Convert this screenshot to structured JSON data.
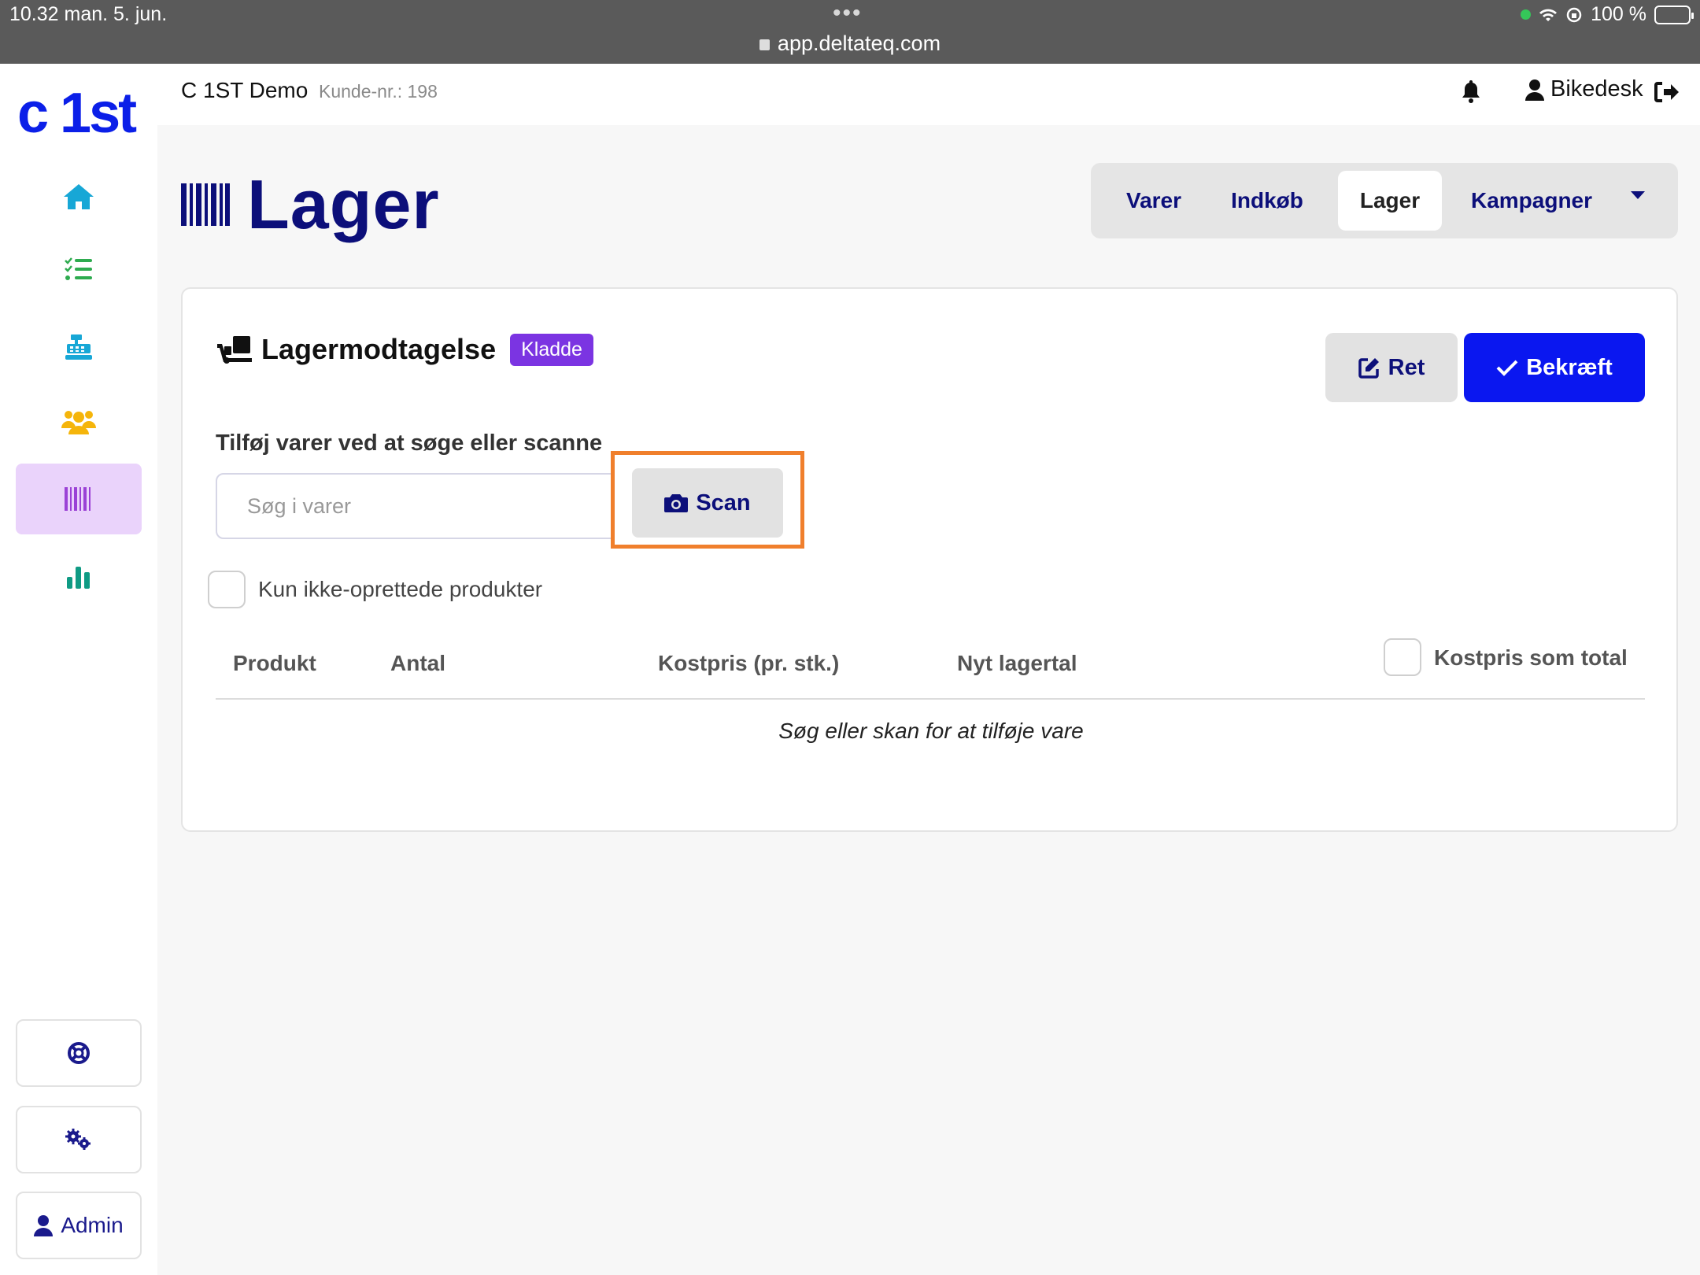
{
  "statusbar": {
    "time_date": "10.32   man. 5. jun.",
    "dots": "•••",
    "url": "app.deltateq.com",
    "battery": "100 %"
  },
  "sidebar": {
    "logo": "c 1st",
    "items": [
      {
        "icon": "home-icon",
        "color": "#17a7d6"
      },
      {
        "icon": "checklist-icon",
        "color": "#2eab4f"
      },
      {
        "icon": "cash-register-icon",
        "color": "#17a7d6"
      },
      {
        "icon": "users-icon",
        "color": "#f5b50b"
      },
      {
        "icon": "barcode-icon",
        "color": "#9b42d6",
        "active": true
      },
      {
        "icon": "chart-icon",
        "color": "#0f9b84"
      }
    ],
    "support_icon": "lifebuoy-icon",
    "settings_icon": "gears-icon",
    "admin_label": "Admin"
  },
  "header": {
    "company": "C 1ST Demo",
    "customer_no": "Kunde-nr.: 198",
    "user": "Bikedesk"
  },
  "page": {
    "title": "Lager",
    "tabs": [
      "Varer",
      "Indkøb",
      "Lager",
      "Kampagner"
    ],
    "active_tab": "Lager"
  },
  "card": {
    "title": "Lagermodtagelse",
    "badge": "Kladde",
    "ret_label": "Ret",
    "confirm_label": "Bekræft",
    "add_label": "Tilføj varer ved at søge eller scanne",
    "search_placeholder": "Søg i varer",
    "scan_label": "Scan",
    "only_new_label": "Kun ikke-oprettede produkter",
    "columns": [
      "Produkt",
      "Antal",
      "Kostpris (pr. stk.)",
      "Nyt lagertal"
    ],
    "cost_total_label": "Kostpris som total",
    "empty_text": "Søg eller skan for at tilføje vare"
  },
  "colors": {
    "brand_blue": "#0a17f0",
    "navy": "#0c0f7a",
    "badge_purple": "#7b34e2",
    "highlight_orange": "#f07f2c"
  }
}
